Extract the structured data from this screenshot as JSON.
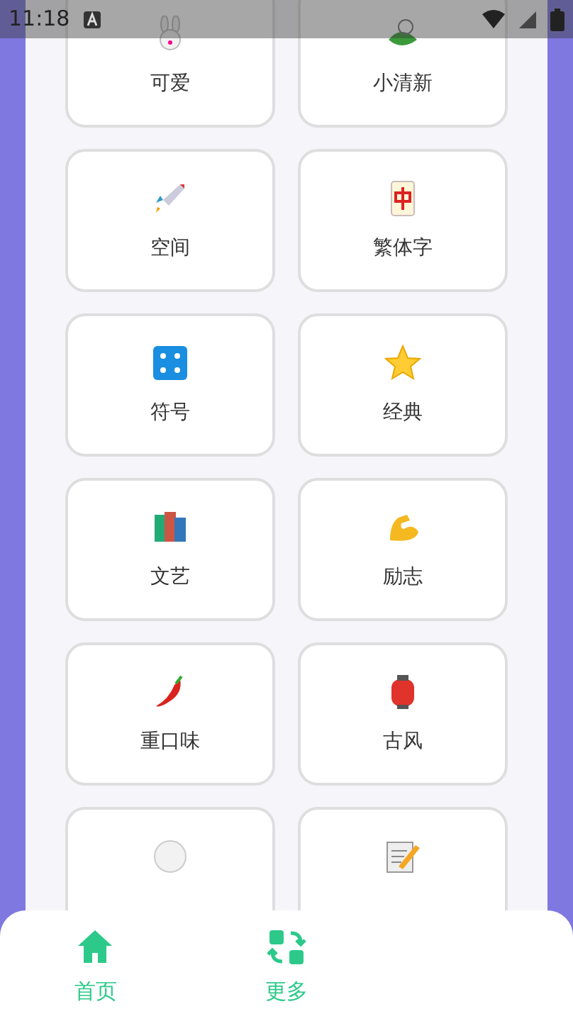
{
  "status_bar": {
    "time": "11:18"
  },
  "categories": [
    {
      "kind": "full",
      "label": "可爱"
    },
    {
      "kind": "full",
      "label": "小清新"
    },
    {
      "kind": "full",
      "label": "空间"
    },
    {
      "kind": "full",
      "label": "繁体字"
    },
    {
      "kind": "full",
      "label": "符号"
    },
    {
      "kind": "full",
      "label": "经典"
    },
    {
      "kind": "full",
      "label": "文艺"
    },
    {
      "kind": "full",
      "label": "励志"
    },
    {
      "kind": "full",
      "label": "重口味"
    },
    {
      "kind": "full",
      "label": "古风"
    },
    {
      "kind": "cut"
    },
    {
      "kind": "cut"
    }
  ],
  "bottom_nav": [
    {
      "label": "首页",
      "kind": "home"
    },
    {
      "label": "更多",
      "kind": "more"
    }
  ]
}
